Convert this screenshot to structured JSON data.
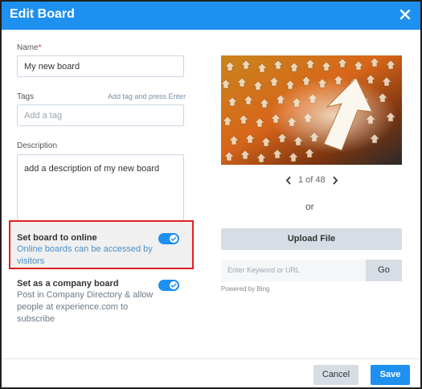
{
  "dialog": {
    "title": "Edit Board",
    "close_icon": "close-icon",
    "accent_color": "#1e90f0"
  },
  "form": {
    "name_label": "Name",
    "name_required_mark": "*",
    "name_value": "My new board",
    "tags_label": "Tags",
    "tags_hint": "Add tag and press Enter",
    "tags_placeholder": "Add a tag",
    "description_label": "Description",
    "description_value": "add a description of my new board"
  },
  "options": {
    "online": {
      "title": "Set board to online",
      "description": "Online boards can be accessed by visitors",
      "enabled": true
    },
    "company": {
      "title": "Set as a company board",
      "description": "Post in Company Directory & allow people at experience.com to subscribe",
      "enabled": true
    }
  },
  "image_panel": {
    "pager_text": "1 of 48",
    "prev_icon": "chevron-left-icon",
    "next_icon": "chevron-right-icon",
    "or_text": "or",
    "upload_label": "Upload File",
    "search_placeholder": "Enter Keyword or URL",
    "go_label": "Go",
    "powered_by": "Powered by Bing"
  },
  "footer": {
    "cancel_label": "Cancel",
    "save_label": "Save"
  }
}
